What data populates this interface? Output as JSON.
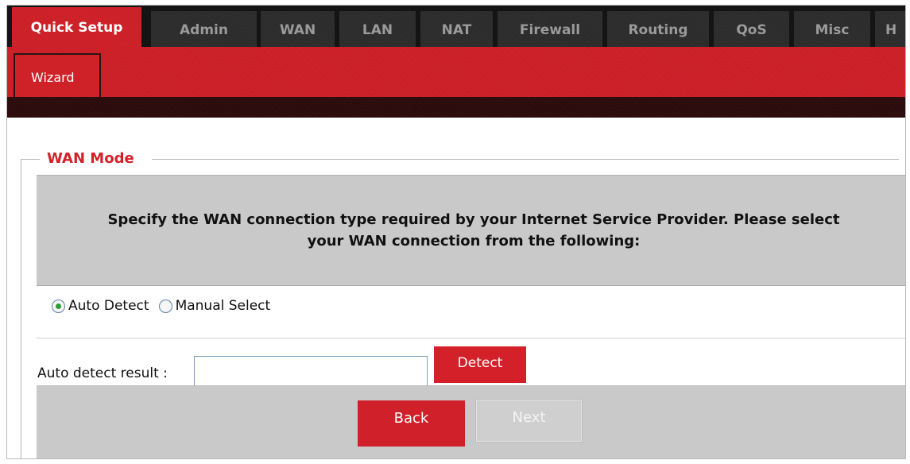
{
  "nav": {
    "tabs": [
      {
        "label": "Quick Setup",
        "active": true
      },
      {
        "label": "Admin"
      },
      {
        "label": "WAN"
      },
      {
        "label": "LAN"
      },
      {
        "label": "NAT"
      },
      {
        "label": "Firewall"
      },
      {
        "label": "Routing"
      },
      {
        "label": "QoS"
      },
      {
        "label": "Misc"
      },
      {
        "label": "H"
      }
    ],
    "subtab": {
      "label": "Wizard"
    }
  },
  "wan_mode": {
    "legend": "WAN Mode",
    "description": "Specify the WAN connection type required by your Internet Service Provider. Please select your WAN connection from the following:",
    "options": [
      {
        "label": "Auto Detect",
        "checked": true
      },
      {
        "label": "Manual Select",
        "checked": false
      }
    ],
    "detect": {
      "label": "Auto detect result :",
      "value": "",
      "button": "Detect"
    },
    "buttons": {
      "back": "Back",
      "next": "Next"
    }
  },
  "colors": {
    "accent": "#d12229",
    "tab_bar": "#141414",
    "panel": "#c9c9c9"
  }
}
